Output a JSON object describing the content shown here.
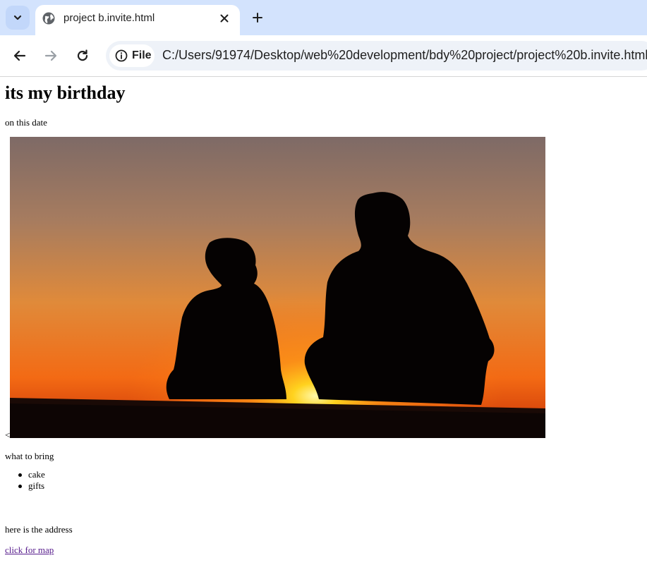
{
  "browser": {
    "tab": {
      "title": "project b.invite.html"
    },
    "address_bar": {
      "scheme_chip": "File",
      "url": "C:/Users/91974/Desktop/web%20development/bdy%20project/project%20b.invite.html"
    },
    "icons": {
      "tab_search": "chevron-down-icon",
      "favicon": "globe-icon",
      "close": "close-icon",
      "new_tab": "plus-icon",
      "back": "back-arrow-icon",
      "forward": "forward-arrow-icon",
      "reload": "reload-icon",
      "site_info": "info-icon"
    },
    "colors": {
      "tabstrip_bg": "#d3e3fd",
      "omnibox_bg": "#eef2f8",
      "link_visited": "#551a8b"
    }
  },
  "page": {
    "heading": "its my birthday",
    "date_text": "on this date",
    "stray_text": "<",
    "image_subject": "silhouette of adult and child at sunset",
    "bring_label": "what to bring",
    "bring_items": [
      "cake",
      "gifts"
    ],
    "address_text": "here is the address",
    "map_link": "click for map"
  }
}
